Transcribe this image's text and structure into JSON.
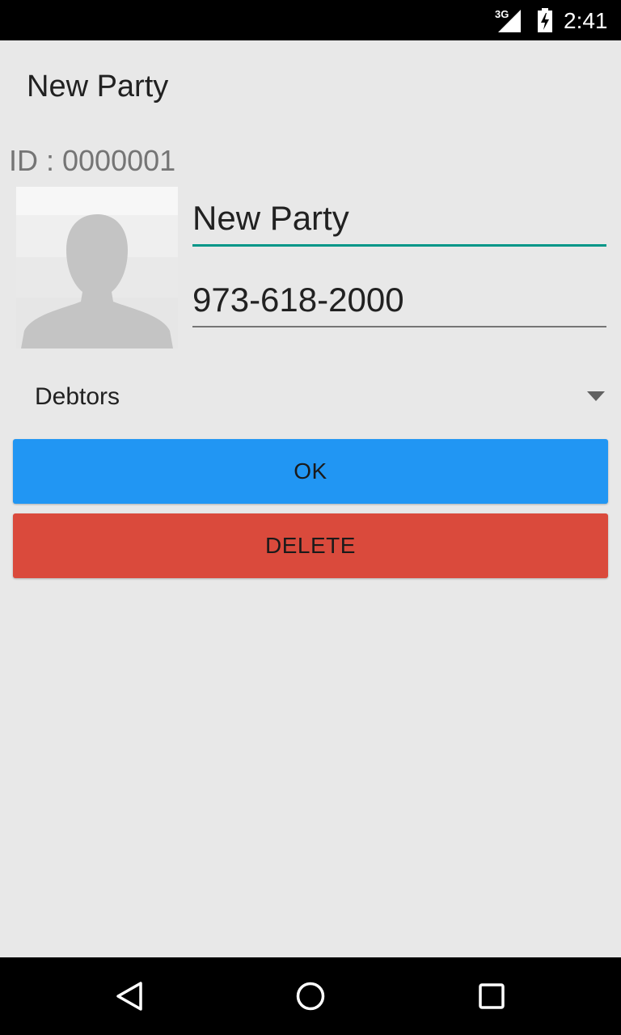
{
  "status_bar": {
    "network": "3G",
    "time": "2:41"
  },
  "screen": {
    "title": "New Party",
    "id_label": "ID : 0000001"
  },
  "form": {
    "name_value": "New Party",
    "phone_value": "973-618-2000",
    "group_selected": "Debtors"
  },
  "buttons": {
    "ok_label": "OK",
    "delete_label": "DELETE"
  },
  "colors": {
    "ok": "#2196f3",
    "delete": "#da4a3c",
    "accent": "#009688"
  },
  "icons": {
    "avatar": "person-placeholder-icon",
    "back": "back-triangle-icon",
    "home": "home-circle-icon",
    "recents": "recents-square-icon"
  }
}
